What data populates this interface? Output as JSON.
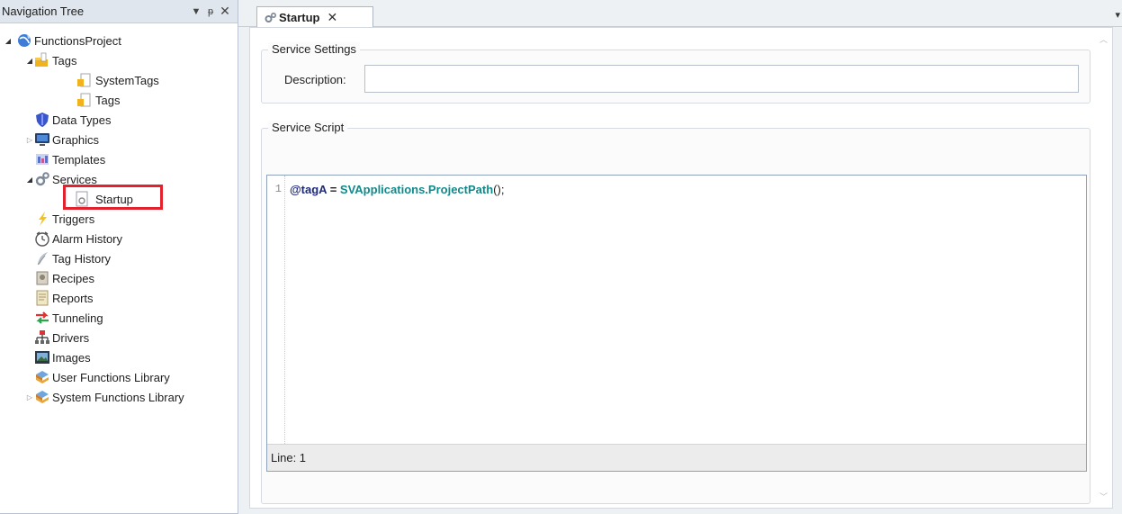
{
  "nav": {
    "title": "Navigation Tree",
    "dropdown_glyph": "▼",
    "pin_glyph": "ᵽ",
    "close_glyph": "✕",
    "items": [
      {
        "label": "FunctionsProject",
        "icon": "globe-icon",
        "expander": "◢",
        "indent": 0
      },
      {
        "label": "Tags",
        "icon": "folder-tag-icon",
        "expander": "◢",
        "indent": 1
      },
      {
        "label": "SystemTags",
        "icon": "tag-icon",
        "expander": "",
        "indent": 2
      },
      {
        "label": "Tags",
        "icon": "tag-icon",
        "expander": "",
        "indent": 2
      },
      {
        "label": "Data Types",
        "icon": "shield-icon",
        "expander": "",
        "indent": 1
      },
      {
        "label": "Graphics",
        "icon": "monitor-icon",
        "expander": "▷",
        "indent": 1
      },
      {
        "label": "Templates",
        "icon": "templates-icon",
        "expander": "",
        "indent": 1
      },
      {
        "label": "Services",
        "icon": "gears-icon",
        "expander": "◢",
        "indent": 1
      },
      {
        "label": "Startup",
        "icon": "service-doc-icon",
        "expander": "",
        "indent": 2
      },
      {
        "label": "Triggers",
        "icon": "lightning-icon",
        "expander": "",
        "indent": 1
      },
      {
        "label": "Alarm History",
        "icon": "clock-icon",
        "expander": "",
        "indent": 1
      },
      {
        "label": "Tag History",
        "icon": "feather-icon",
        "expander": "",
        "indent": 1
      },
      {
        "label": "Recipes",
        "icon": "recipe-icon",
        "expander": "",
        "indent": 1
      },
      {
        "label": "Reports",
        "icon": "report-icon",
        "expander": "",
        "indent": 1
      },
      {
        "label": "Tunneling",
        "icon": "arrows-icon",
        "expander": "",
        "indent": 1
      },
      {
        "label": "Drivers",
        "icon": "network-icon",
        "expander": "",
        "indent": 1
      },
      {
        "label": "Images",
        "icon": "image-icon",
        "expander": "",
        "indent": 1
      },
      {
        "label": "User Functions Library",
        "icon": "library-icon",
        "expander": "",
        "indent": 1
      },
      {
        "label": "System Functions Library",
        "icon": "library-icon",
        "expander": "▷",
        "indent": 1
      }
    ]
  },
  "tab": {
    "label": "Startup",
    "icon": "gears-icon",
    "close_glyph": "✕",
    "menu_glyph": "▾"
  },
  "service_settings": {
    "title": "Service Settings",
    "description_label": "Description:",
    "description_value": ""
  },
  "service_script": {
    "title": "Service Script",
    "line_number": "1",
    "code": {
      "var": "@tagA",
      "op": " = ",
      "obj": "SVApplications.ProjectPath",
      "punct": "();"
    },
    "status": "Line: 1"
  },
  "colors": {
    "highlight": "#e2222c",
    "code_object": "#0f8a8a",
    "code_variable": "#1e2a78"
  }
}
